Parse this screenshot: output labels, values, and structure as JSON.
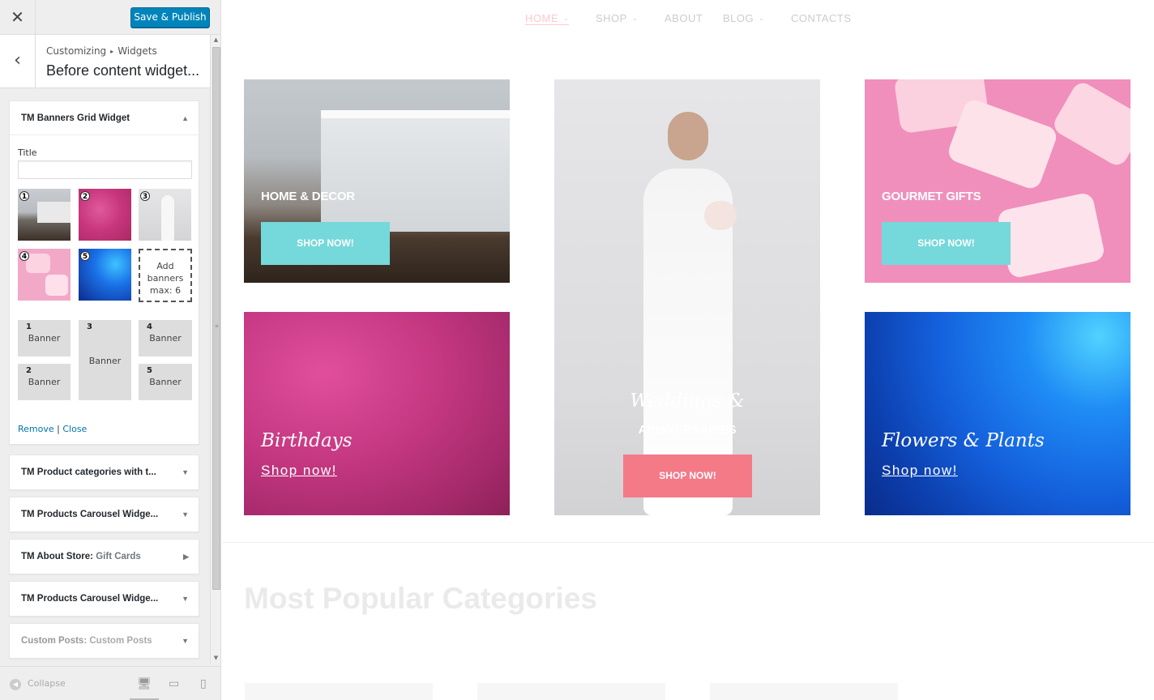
{
  "customizer": {
    "close_icon": "close-icon",
    "save_label": "Save & Publish",
    "breadcrumb_root": "Customizing",
    "breadcrumb_current": "Widgets",
    "panel_title": "Before content widget...",
    "colors": {
      "primary_button": "#0085ba",
      "link": "#0073aa"
    }
  },
  "banners_widget": {
    "title": "TM Banners Grid Widget",
    "field_label": "Title",
    "field_value": "",
    "thumbnails": [
      "1",
      "2",
      "3",
      "4",
      "5"
    ],
    "add_banners": {
      "line1": "Add",
      "line2": "banners",
      "line3": "max: 6"
    },
    "layout": [
      {
        "num": "1",
        "label": "Banner"
      },
      {
        "num": "2",
        "label": "Banner"
      },
      {
        "num": "3",
        "label": "Banner"
      },
      {
        "num": "4",
        "label": "Banner"
      },
      {
        "num": "5",
        "label": "Banner"
      }
    ],
    "remove_label": "Remove",
    "separator": "|",
    "close_label": "Close"
  },
  "widgets": [
    {
      "title": "TM Product categories with t..."
    },
    {
      "title": "TM Products Carousel Widge..."
    },
    {
      "title": "TM About Store:",
      "sub": "Gift Cards"
    },
    {
      "title": "TM Products Carousel Widge..."
    },
    {
      "title": "Custom Posts:",
      "sub": "Custom Posts"
    }
  ],
  "footer": {
    "collapse_label": "Collapse"
  },
  "nav": {
    "items": [
      "HOME",
      "SHOP",
      "ABOUT",
      "BLOG",
      "CONTACTS"
    ],
    "active_color": "#ffc8cf"
  },
  "banners": [
    {
      "title": "HOME & DECOR",
      "button": "SHOP NOW!",
      "button_color": "#75d8da"
    },
    {
      "script": "Weddings &",
      "title": "ANNIVERSARIES",
      "button": "SHOP NOW!",
      "button_color": "#f47a88"
    },
    {
      "title": "GOURMET GIFTS",
      "button": "SHOP NOW!",
      "button_color": "#75d8da"
    },
    {
      "script": "Birthdays",
      "link": "Shop now!"
    },
    {
      "script": "Flowers & Plants",
      "link": "Shop now!"
    }
  ],
  "section_heading": "Most Popular Categories"
}
